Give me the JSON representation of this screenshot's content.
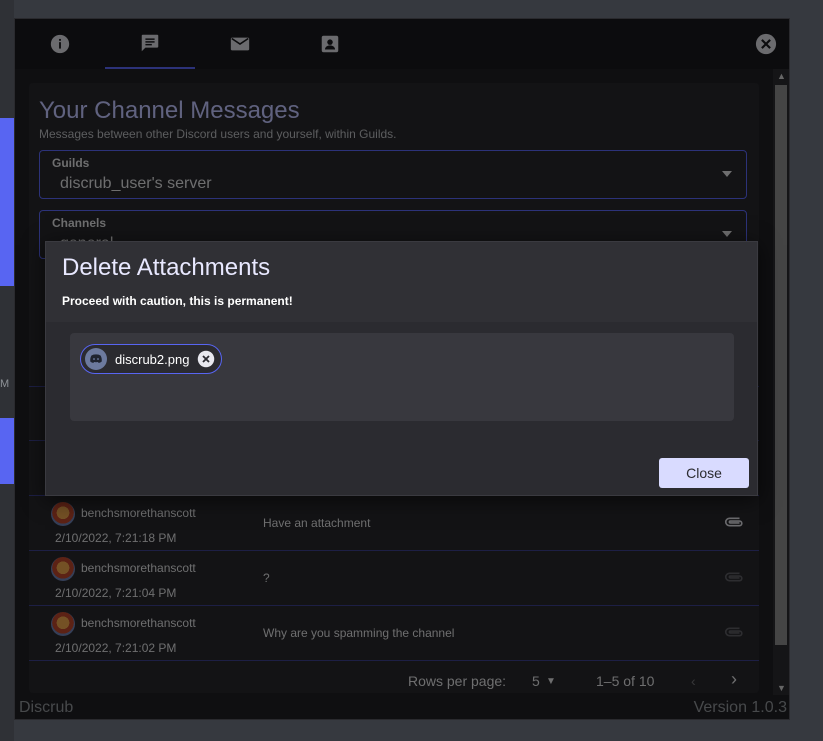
{
  "background": {
    "side_text": "M"
  },
  "window": {
    "tabs": [
      {
        "icon": "info-icon"
      },
      {
        "icon": "chat-icon",
        "active": true
      },
      {
        "icon": "mail-icon"
      },
      {
        "icon": "contact-icon"
      }
    ],
    "close_icon": "close-icon"
  },
  "page": {
    "title": "Your Channel Messages",
    "subtitle": "Messages between other Discord users and yourself, within Guilds.",
    "guild_select": {
      "label": "Guilds",
      "value": "discrub_user's server"
    },
    "channel_select": {
      "label": "Channels",
      "value": "general"
    }
  },
  "messages": [
    {
      "username": "benchsmorethanscott",
      "timestamp": "2/10/2022, 7:21:18 PM",
      "content": "Have an attachment",
      "has_attachment": true
    },
    {
      "username": "benchsmorethanscott",
      "timestamp": "2/10/2022, 7:21:04 PM",
      "content": "?",
      "has_attachment": false
    },
    {
      "username": "benchsmorethanscott",
      "timestamp": "2/10/2022, 7:21:02 PM",
      "content": "Why are you spamming the channel",
      "has_attachment": false
    }
  ],
  "pagination": {
    "rows_label": "Rows per page:",
    "rows_value": "5",
    "range": "1–5 of 10"
  },
  "status_bar": {
    "app_name": "Discrub",
    "version": "Version 1.0.3"
  },
  "dialog": {
    "title": "Delete Attachments",
    "warning": "Proceed with caution, this is permanent!",
    "attachments": [
      {
        "filename": "discrub2.png"
      }
    ],
    "close_label": "Close"
  },
  "colors": {
    "accent": "#5865f2",
    "title": "#c0c4ff",
    "button": "#d9dbff"
  }
}
